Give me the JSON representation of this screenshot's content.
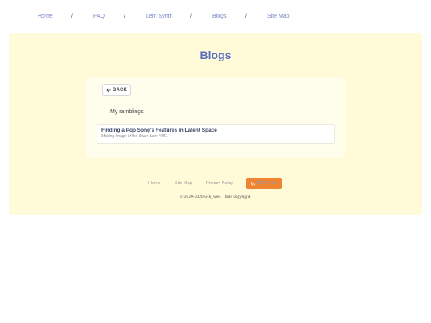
{
  "nav": {
    "items": [
      "Home",
      "FAQ",
      "Lem Synth",
      "Blogs",
      "Site Map"
    ],
    "separator": "/"
  },
  "main": {
    "title": "Blogs",
    "back_label": "BACK",
    "section_heading": "My ramblings:",
    "posts": [
      {
        "title": "Finding a Pop Song's Features in Latent Space",
        "subtitle": "Making Image of the River, Lem VAE."
      }
    ]
  },
  "footer": {
    "links": [
      "Home",
      "Site Map",
      "Privacy Policy"
    ],
    "rss_label": "RSS Feed",
    "copyright": "2020-2026 wik_wee. I hate copyright."
  },
  "colors": {
    "nav_link": "#7b86c4",
    "title": "#5b6fc0",
    "main_bg": "#fffbd9",
    "rss_bg": "#ef8433"
  },
  "icons": {
    "back": "arrow-left-icon",
    "rss": "rss-icon",
    "copyright": "copyright-icon"
  }
}
